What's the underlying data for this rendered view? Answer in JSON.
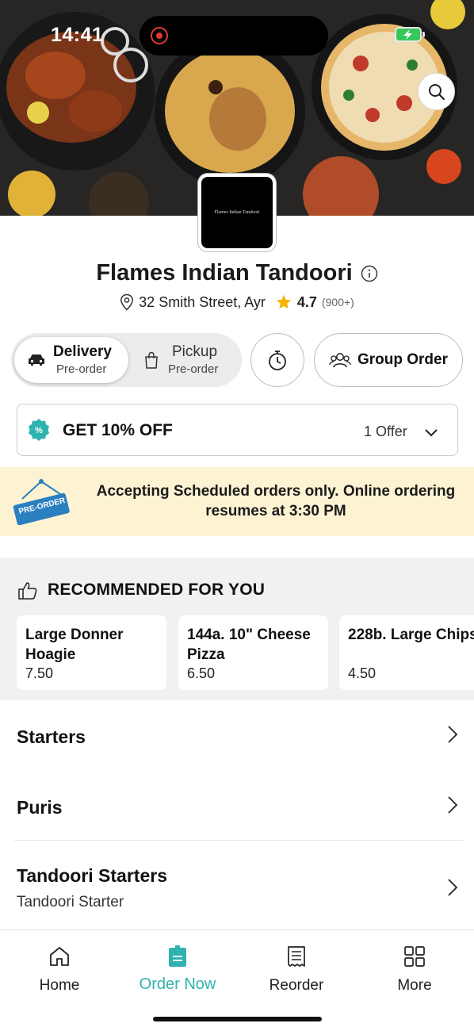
{
  "status_bar": {
    "time": "14:41"
  },
  "restaurant": {
    "logo_text": "Flames Indian Tandoori",
    "name": "Flames Indian Tandoori",
    "address": "32 Smith Street, Ayr",
    "rating": "4.7",
    "rating_count": "(900+)"
  },
  "order_mode": {
    "delivery": {
      "label": "Delivery",
      "sub": "Pre-order"
    },
    "pickup": {
      "label": "Pickup",
      "sub": "Pre-order"
    },
    "group_order": "Group Order"
  },
  "offer": {
    "title": "GET 10% OFF",
    "count": "1 Offer"
  },
  "banner": {
    "tag": "PRE-ORDER",
    "text": "Accepting Scheduled orders only. Online ordering resumes at 3:30 PM"
  },
  "recommended": {
    "title": "RECOMMENDED FOR YOU",
    "items": [
      {
        "name_line1": "Large Donner",
        "name_line2": "Hoagie",
        "price": "7.50"
      },
      {
        "name_line1": "144a. 10\" Cheese",
        "name_line2": "Pizza",
        "price": "6.50"
      },
      {
        "name_line1": "228b. Large Chips",
        "name_line2": "",
        "price": "4.50"
      }
    ]
  },
  "categories": [
    {
      "name": "Starters",
      "sub": ""
    },
    {
      "name": "Puris",
      "sub": ""
    },
    {
      "name": "Tandoori Starters",
      "sub": "Tandoori Starter"
    }
  ],
  "tabs": [
    {
      "label": "Home",
      "icon": "home-icon"
    },
    {
      "label": "Order Now",
      "icon": "order-icon"
    },
    {
      "label": "Reorder",
      "icon": "receipt-icon"
    },
    {
      "label": "More",
      "icon": "grid-icon"
    }
  ],
  "colors": {
    "accent": "#2fb3b0",
    "banner_bg": "#fdf3d3",
    "rating_star": "#f4b400",
    "preorder_tag": "#2a7fc1"
  }
}
